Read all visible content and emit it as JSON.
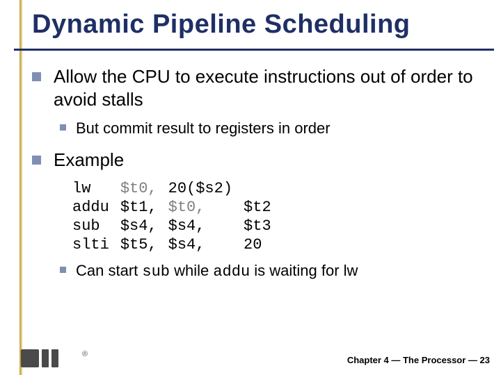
{
  "title": "Dynamic Pipeline Scheduling",
  "bullets": {
    "b1_allow": "Allow the CPU to execute instructions out of order to avoid stalls",
    "b2_commit": "But commit result to registers in order",
    "b1_example": "Example",
    "b3_pre": "Can start ",
    "b3_code1": "sub",
    "b3_mid": " while ",
    "b3_code2": "addu",
    "b3_post": " is waiting for lw"
  },
  "code": {
    "rows": [
      {
        "op": "lw",
        "d": "$t0,",
        "s1": "20($s2)",
        "s2": ""
      },
      {
        "op": "addu",
        "d": "$t1,",
        "s1": "$t0,",
        "s2": "$t2"
      },
      {
        "op": "sub",
        "d": "$s4,",
        "s1": "$s4,",
        "s2": "$t3"
      },
      {
        "op": "slti",
        "d": "$t5,",
        "s1": "$s4,",
        "s2": "20"
      }
    ]
  },
  "footer": {
    "reg": "®",
    "text": "Chapter 4 — The Processor — 23"
  }
}
